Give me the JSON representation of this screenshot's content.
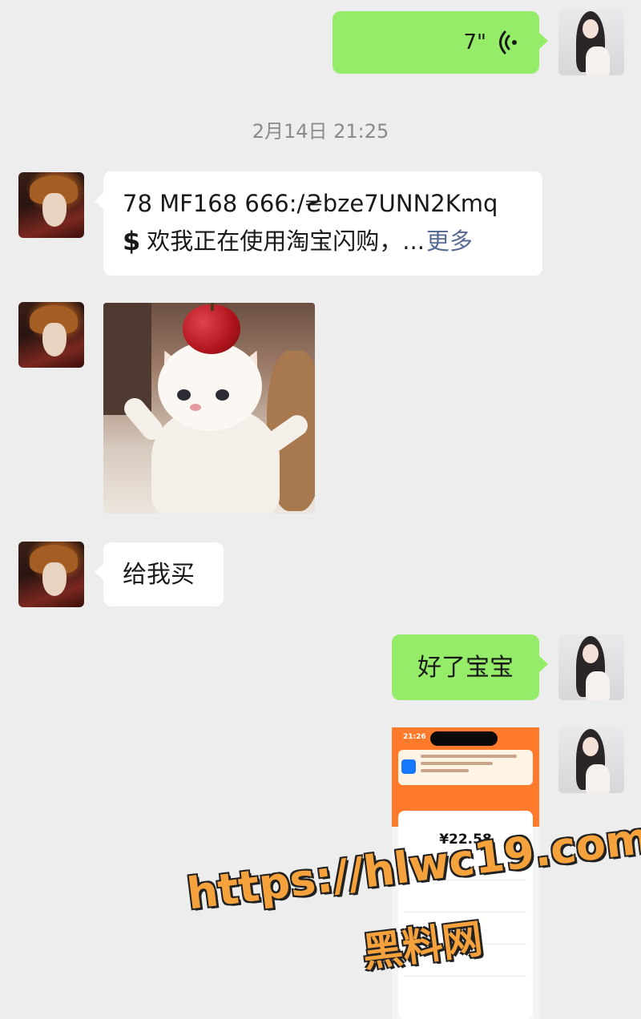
{
  "chat": {
    "timestamp": "2月14日 21:25",
    "voice_message": {
      "duration": "7\"",
      "icon": "voice-wave-icon"
    },
    "link_message": {
      "line1": "78 MF168 666:/₴bze7UNN2Kmq",
      "symbol": "$",
      "line2": "欢我正在使用淘宝闪购，...",
      "more": "更多"
    },
    "text_buy": "给我买",
    "text_ok": "好了宝宝",
    "screenshot": {
      "time": "21:26",
      "amount": "¥22.58"
    }
  },
  "watermark": {
    "url": "https://hlwc19.com",
    "name": "黑料网"
  },
  "colors": {
    "background": "#ededed",
    "self_bubble": "#95ec69",
    "other_bubble": "#ffffff",
    "link_more": "#576b95",
    "watermark": "#f6a23c"
  }
}
